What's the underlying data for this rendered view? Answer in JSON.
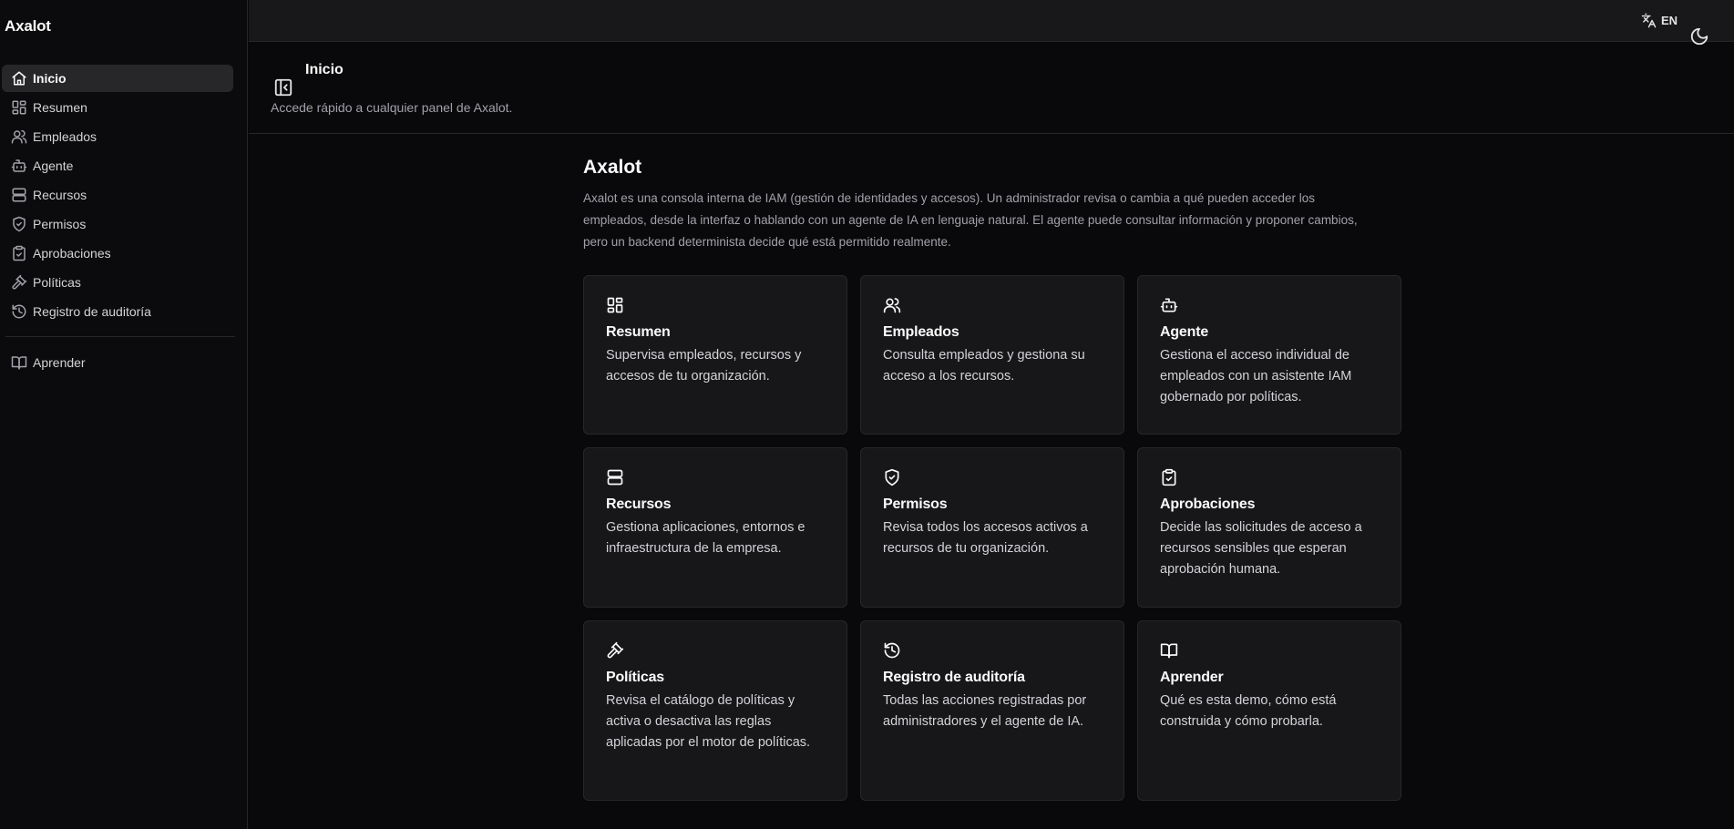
{
  "app": {
    "brand": "Axalot"
  },
  "sidebar": {
    "items": [
      {
        "label": "Inicio",
        "icon": "home-icon",
        "active": true
      },
      {
        "label": "Resumen",
        "icon": "dashboard-icon"
      },
      {
        "label": "Empleados",
        "icon": "users-icon"
      },
      {
        "label": "Agente",
        "icon": "bot-icon"
      },
      {
        "label": "Recursos",
        "icon": "server-icon"
      },
      {
        "label": "Permisos",
        "icon": "shield-check-icon"
      },
      {
        "label": "Aprobaciones",
        "icon": "clipboard-check-icon"
      },
      {
        "label": "Políticas",
        "icon": "gavel-icon"
      },
      {
        "label": "Registro de auditoría",
        "icon": "history-icon"
      }
    ],
    "secondary": [
      {
        "label": "Aprender",
        "icon": "book-open-icon"
      }
    ]
  },
  "topbar": {
    "language": "EN",
    "language_icon": "translate-icon",
    "theme_icon": "moon-icon"
  },
  "page": {
    "title": "Inicio",
    "subtitle": "Accede rápido a cualquier panel de Axalot."
  },
  "main": {
    "heading": "Axalot",
    "intro": "Axalot es una consola interna de IAM (gestión de identidades y accesos). Un administrador revisa o cambia a qué pueden acceder los empleados, desde la interfaz o hablando con un agente de IA en lenguaje natural. El agente puede consultar información y proponer cambios, pero un backend determinista decide qué está permitido realmente.",
    "cards": [
      {
        "title": "Resumen",
        "icon": "dashboard-icon",
        "description": "Supervisa empleados, recursos y accesos de tu organización."
      },
      {
        "title": "Empleados",
        "icon": "users-icon",
        "description": "Consulta empleados y gestiona su acceso a los recursos."
      },
      {
        "title": "Agente",
        "icon": "bot-icon",
        "description": "Gestiona el acceso individual de empleados con un asistente IAM gobernado por políticas."
      },
      {
        "title": "Recursos",
        "icon": "server-icon",
        "description": "Gestiona aplicaciones, entornos e infraestructura de la empresa."
      },
      {
        "title": "Permisos",
        "icon": "shield-check-icon",
        "description": "Revisa todos los accesos activos a recursos de tu organización."
      },
      {
        "title": "Aprobaciones",
        "icon": "clipboard-check-icon",
        "description": "Decide las solicitudes de acceso a recursos sensibles que esperan aprobación humana."
      },
      {
        "title": "Políticas",
        "icon": "gavel-icon",
        "description": "Revisa el catálogo de políticas y activa o desactiva las reglas aplicadas por el motor de políticas."
      },
      {
        "title": "Registro de auditoría",
        "icon": "history-icon",
        "description": "Todas las acciones registradas por administradores y el agente de IA."
      },
      {
        "title": "Aprender",
        "icon": "book-open-icon",
        "description": "Qué es esta demo, cómo está construida y cómo probarla."
      }
    ]
  }
}
